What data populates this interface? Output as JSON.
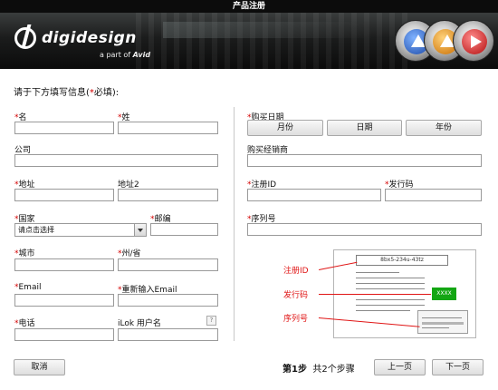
{
  "window": {
    "title": "产品注册"
  },
  "banner": {
    "brand": "digidesign",
    "tagline_prefix": "a part of",
    "tagline_brand": "Avid"
  },
  "form": {
    "prompt_before": "请于下方填写信息(",
    "required_mark": "*",
    "prompt_after": "必填):",
    "fields": {
      "first_name": "名",
      "last_name": "姓",
      "company": "公司",
      "address": "地址",
      "address2": "地址2",
      "country": "国家",
      "country_select": "请点击选择",
      "postal_code": "邮编",
      "city": "城市",
      "state": "州/省",
      "email": "Email",
      "email_confirm": "重新输入Email",
      "phone": "电话",
      "ilok_user": "iLok 用户名",
      "help_glyph": "?"
    },
    "right": {
      "purchase_date": "购买日期",
      "month": "月份",
      "day": "日期",
      "year": "年份",
      "dealer": "购买经销商",
      "registration_id": "注册ID",
      "issue_code": "发行码",
      "serial": "序列号"
    }
  },
  "diagram": {
    "code": "8bx5-234u-43tz",
    "green": "XXXX",
    "callouts": {
      "reg_id": "注册ID",
      "issue": "发行码",
      "serial": "序列号"
    },
    "accent_red": "#e01515",
    "accent_green": "#13a613"
  },
  "footer": {
    "cancel": "取消",
    "step_bold": "第1步",
    "step_rest": "共2个步骤",
    "prev": "上一页",
    "next": "下一页"
  }
}
